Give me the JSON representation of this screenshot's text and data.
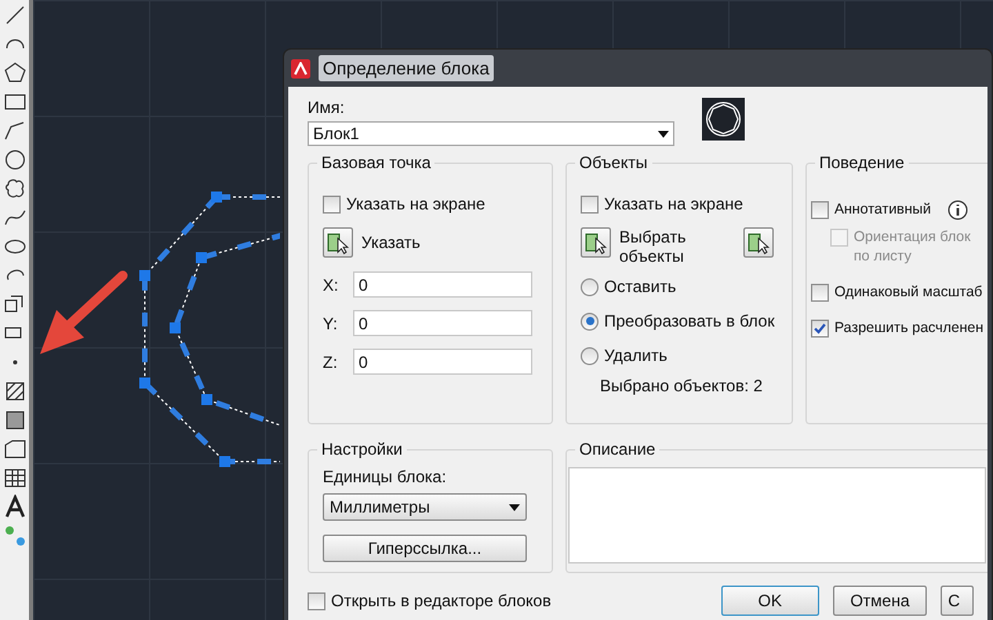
{
  "window": {
    "title": "Определение блока"
  },
  "name_field": {
    "label": "Имя:",
    "value": "Блок1"
  },
  "base_point": {
    "title": "Базовая точка",
    "specify_on_screen": {
      "label": "Указать на экране",
      "checked": false
    },
    "pick_button": "Указать",
    "coords": [
      {
        "label": "X:",
        "value": "0"
      },
      {
        "label": "Y:",
        "value": "0"
      },
      {
        "label": "Z:",
        "value": "0"
      }
    ]
  },
  "objects": {
    "title": "Объекты",
    "specify_on_screen": {
      "label": "Указать на экране",
      "checked": false
    },
    "select_button": "Выбрать\nобъекты",
    "options": [
      {
        "label": "Оставить",
        "selected": false
      },
      {
        "label": "Преобразовать в блок",
        "selected": true
      },
      {
        "label": "Удалить",
        "selected": false
      }
    ],
    "selected_count": "Выбрано объектов: 2"
  },
  "behavior": {
    "title": "Поведение",
    "options": [
      {
        "label": "Аннотативный",
        "checked": false,
        "disabled": false,
        "info": true,
        "children": [
          {
            "label": "Ориентация блок\nпо листу",
            "checked": false,
            "disabled": true
          }
        ]
      },
      {
        "label": "Одинаковый масштаб",
        "checked": false,
        "disabled": false,
        "info": false
      },
      {
        "label": "Разрешить расчленен",
        "checked": true,
        "disabled": false,
        "info": false
      }
    ]
  },
  "settings": {
    "title": "Настройки",
    "units_label": "Единицы блока:",
    "units_value": "Миллиметры",
    "hyperlink_button": "Гиперссылка..."
  },
  "description": {
    "title": "Описание"
  },
  "open_in_editor": {
    "label": "Открыть в редакторе блоков",
    "checked": false
  },
  "buttons": [
    {
      "label": "OK",
      "default": true
    },
    {
      "label": "Отмена",
      "default": false
    },
    {
      "label": "С",
      "default": false
    }
  ]
}
